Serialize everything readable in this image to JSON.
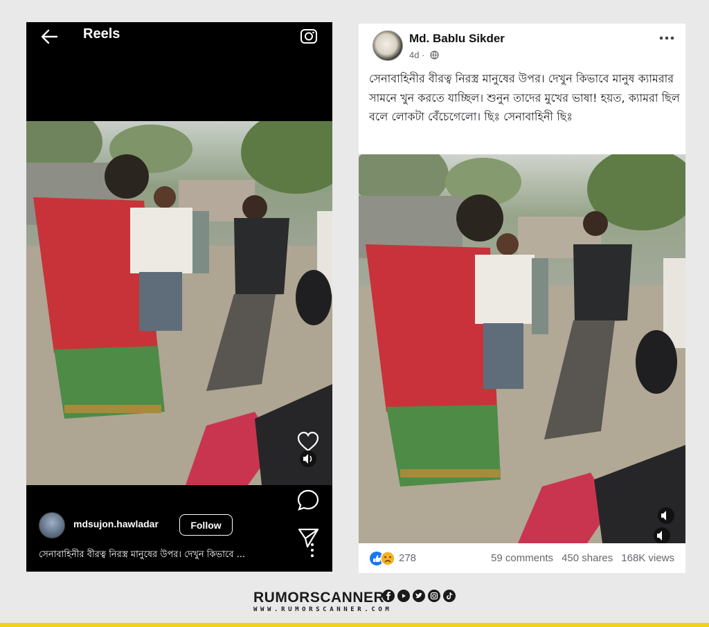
{
  "instagram": {
    "header_title": "Reels",
    "username": "mdsujon.hawladar",
    "follow_label": "Follow",
    "caption": "সেনাবাহিনীর বীরত্ব নিরস্ত্র মানুষের উপর। দেখুন কিভাবে ..."
  },
  "facebook": {
    "author": "Md. Bablu Sikder",
    "time": "4d ·",
    "post_text": "সেনাবাহিনীর বীরত্ব নিরস্ত্র মানুষের উপর। দেখুন কিভাবে মানুষ ক্যামরার সামনে খুন করতে যাচ্ছিল। শুনুন তাদের মুখের ভাষা! হয়ত, ক্যামরা ছিল বলে লোকটা বেঁচেগেলো। ছিঃ সেনাবাহিনী ছিঃ",
    "reactions_count": "278",
    "comments": "59 comments",
    "shares": "450 shares",
    "views": "168K views"
  },
  "brand": {
    "name": "RUMORSCANNER",
    "url": "WWW.RUMORSCANNER.COM"
  },
  "colors": {
    "brand_yellow": "#f1d21b",
    "facebook_blue": "#1877f2",
    "follower_text": "#65676b"
  }
}
